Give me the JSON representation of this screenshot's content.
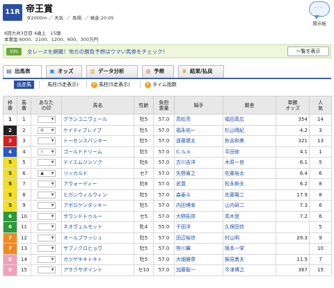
{
  "header": {
    "race_no": "11R",
    "title": "帝王賞",
    "meta": "ダ2000m ／ 天気: ／ 馬場: ／ 発走:20:05",
    "info_line1": "6回大井3日目 4歳上　15頭",
    "info_line2": "本賞金:6000、2100、1200、600、300万円",
    "post_button": "掲示板"
  },
  "banner": {
    "tag": "info",
    "text": "全レースを網羅！地方の勝負予想はウマい馬券をチェック！",
    "button": "一覧を表示"
  },
  "tabs": [
    {
      "label": "出馬表",
      "icon": "list-icon"
    },
    {
      "label": "オッズ",
      "icon": "odds-icon"
    },
    {
      "label": "データ分析",
      "icon": "bar-chart-icon"
    },
    {
      "label": "予想",
      "icon": "target-icon"
    },
    {
      "label": "結果/払戻",
      "icon": "trophy-icon"
    }
  ],
  "subtabs": [
    {
      "label": "出走馬"
    },
    {
      "label": "馬柱(5走表示)"
    },
    {
      "label": "馬柱(5走表示)"
    },
    {
      "label": "タイム指数"
    }
  ],
  "table": {
    "headers": [
      "枠\n番",
      "馬\n番",
      "あなた\nの印",
      "馬名",
      "性齢",
      "負担\n重量",
      "騎手",
      "厩舎",
      "単勝\nオッズ",
      "人\n気"
    ],
    "rows": [
      {
        "waku": "1",
        "num": "1",
        "mark": "",
        "name": "グランユニヴェール",
        "sexage": "牡5",
        "weight": "57.0",
        "jockey": "高松亮",
        "trainer": "福田真広",
        "odds": "354",
        "pop": "14"
      },
      {
        "waku": "2",
        "num": "2",
        "mark": "◎",
        "name": "ケイティブレイブ",
        "sexage": "牡5",
        "weight": "57.0",
        "jockey": "福永祐一",
        "trainer": "杉山晴紀",
        "odds": "4.2",
        "pop": "3"
      },
      {
        "waku": "3",
        "num": "3",
        "mark": "",
        "name": "トーセンスパンキー",
        "sexage": "牡5",
        "weight": "57.0",
        "jockey": "遠藤健太",
        "trainer": "秋吉和美",
        "odds": "321",
        "pop": "13"
      },
      {
        "waku": "4",
        "num": "4",
        "mark": "☆",
        "name": "ゴールドドリーム",
        "sexage": "牡5",
        "weight": "57.0",
        "jockey": "C.ルメ",
        "trainer": "平田修",
        "odds": "4.1",
        "pop": "1"
      },
      {
        "waku": "5",
        "num": "5",
        "mark": "",
        "name": "テイエムジンソク",
        "sexage": "牡6",
        "weight": "57.0",
        "jockey": "古川吉洋",
        "trainer": "木原一良",
        "odds": "6.1",
        "pop": "5"
      },
      {
        "waku": "5",
        "num": "6",
        "mark": "▲",
        "name": "リッカルド",
        "sexage": "セ7",
        "weight": "57.0",
        "jockey": "矢野貴之",
        "trainer": "佐藤裕太",
        "odds": "6.4",
        "pop": "6"
      },
      {
        "waku": "5",
        "num": "7",
        "mark": "",
        "name": "アウォーディー",
        "sexage": "牡8",
        "weight": "57.0",
        "jockey": "武豊",
        "trainer": "松永幹夫",
        "odds": "6.2",
        "pop": "8"
      },
      {
        "waku": "5",
        "num": "8",
        "mark": "",
        "name": "ヒガシウィルウィン",
        "sexage": "牡5",
        "weight": "57.0",
        "jockey": "森泰斗",
        "trainer": "佐藤賢二",
        "odds": "17.9",
        "pop": "8"
      },
      {
        "waku": "5",
        "num": "9",
        "mark": "",
        "name": "アポロケンタッキー",
        "sexage": "牡5",
        "weight": "57.0",
        "jockey": "内田博幸",
        "trainer": "山内研二",
        "odds": "7.3",
        "pop": "6"
      },
      {
        "waku": "6",
        "num": "10",
        "mark": "",
        "name": "サウンドトゥルー",
        "sexage": "セ5",
        "weight": "57.0",
        "jockey": "大野拓弥",
        "trainer": "高木登",
        "odds": "7.2",
        "pop": "6"
      },
      {
        "waku": "6",
        "num": "11",
        "mark": "",
        "name": "ネオヴェルモット",
        "sexage": "牝4",
        "weight": "55.0",
        "jockey": "千田洋",
        "trainer": "久保田信",
        "odds": "",
        "pop": "5"
      },
      {
        "waku": "7",
        "num": "12",
        "mark": "",
        "name": "オールブラッシュ",
        "sexage": "牡5",
        "weight": "57.0",
        "jockey": "田辺裕信",
        "trainer": "村山明",
        "odds": "29.3",
        "pop": "9"
      },
      {
        "waku": "7",
        "num": "13",
        "mark": "",
        "name": "サブノクロヒョウ",
        "sexage": "牡5",
        "weight": "57.0",
        "jockey": "笹川翼",
        "trainer": "阪本一栄",
        "odds": "",
        "pop": "10"
      },
      {
        "waku": "8",
        "num": "14",
        "mark": "",
        "name": "カツゲキキトキト",
        "sexage": "牡5",
        "weight": "57.0",
        "jockey": "大畑雅章",
        "trainer": "錦見勇夫",
        "odds": "11.5",
        "pop": "7"
      },
      {
        "waku": "8",
        "num": "15",
        "mark": "",
        "name": "アサクサポイント",
        "sexage": "セ10",
        "weight": "57.0",
        "jockey": "加藤聡一",
        "trainer": "今津博之",
        "odds": "367",
        "pop": "15"
      }
    ]
  },
  "colors": {
    "accent": "#2a4fa3",
    "link": "#1a4fa8",
    "banner_bg": "#eef6dc"
  }
}
